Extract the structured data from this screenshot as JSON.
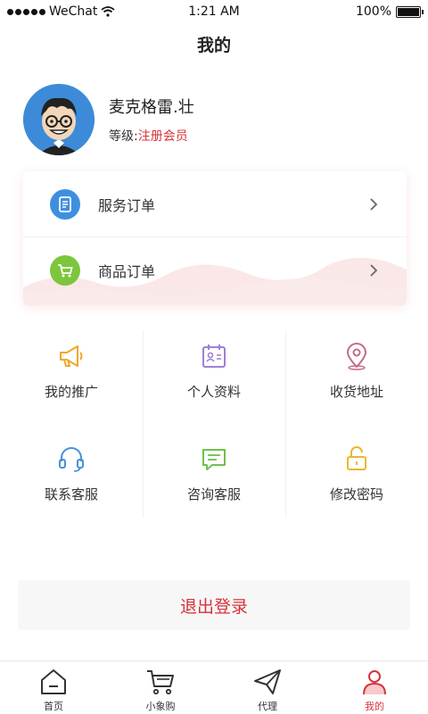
{
  "status_bar": {
    "carrier": "WeChat",
    "time": "1:21 AM",
    "battery": "100%",
    "battery_level": 1.0
  },
  "page": {
    "title": "我的"
  },
  "profile": {
    "username": "麦克格雷.壮",
    "level_label": "等级:",
    "level_value": "注册会员"
  },
  "orders": [
    {
      "label": "服务订单",
      "icon": "document-icon"
    },
    {
      "label": "商品订单",
      "icon": "cart-icon"
    }
  ],
  "menu": [
    {
      "label": "我的推广",
      "icon": "megaphone-icon"
    },
    {
      "label": "个人资料",
      "icon": "id-card-icon"
    },
    {
      "label": "收货地址",
      "icon": "location-pin-icon"
    },
    {
      "label": "联系客服",
      "icon": "headset-icon"
    },
    {
      "label": "咨询客服",
      "icon": "chat-bubble-icon"
    },
    {
      "label": "修改密码",
      "icon": "lock-icon"
    }
  ],
  "logout_label": "退出登录",
  "tabs": [
    {
      "label": "首页",
      "icon": "home-icon"
    },
    {
      "label": "小象购",
      "icon": "cart-icon"
    },
    {
      "label": "代理",
      "icon": "paper-plane-icon"
    },
    {
      "label": "我的",
      "icon": "profile-icon",
      "active": true
    }
  ],
  "colors": {
    "accent": "#d6333a",
    "order_service": "#3f8fe0",
    "order_goods": "#7cc63c",
    "promo": "#f0a72a",
    "profile_card": "#a07fd6",
    "address": "#c46b8a",
    "support": "#4a8fd8",
    "consult": "#6cc24a",
    "password": "#eab82a"
  }
}
